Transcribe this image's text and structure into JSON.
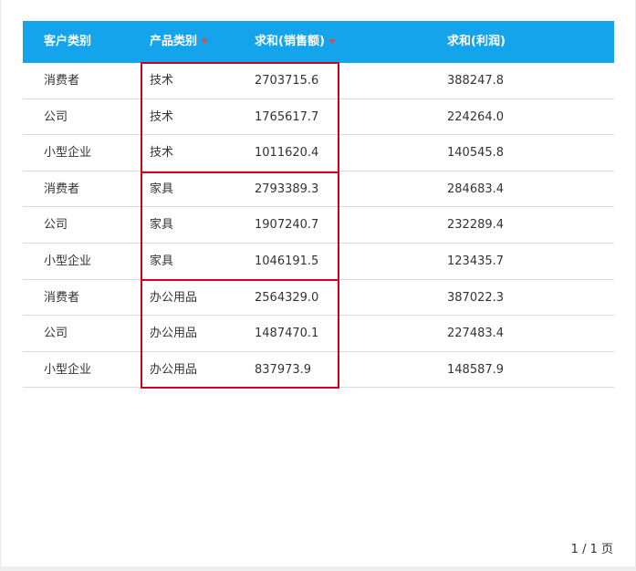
{
  "headers": {
    "customer_type": "客户类别",
    "product_type": "产品类别",
    "sum_sales": "求和(销售额)",
    "sum_profit": "求和(利润)"
  },
  "rows": [
    {
      "customer": "消费者",
      "category": "技术",
      "sales": "2703715.6",
      "profit": "388247.8"
    },
    {
      "customer": "公司",
      "category": "技术",
      "sales": "1765617.7",
      "profit": "224264.0"
    },
    {
      "customer": "小型企业",
      "category": "技术",
      "sales": "1011620.4",
      "profit": "140545.8"
    },
    {
      "customer": "消费者",
      "category": "家具",
      "sales": "2793389.3",
      "profit": "284683.4"
    },
    {
      "customer": "公司",
      "category": "家具",
      "sales": "1907240.7",
      "profit": "232289.4"
    },
    {
      "customer": "小型企业",
      "category": "家具",
      "sales": "1046191.5",
      "profit": "123435.7"
    },
    {
      "customer": "消费者",
      "category": "办公用品",
      "sales": "2564329.0",
      "profit": "387022.3"
    },
    {
      "customer": "公司",
      "category": "办公用品",
      "sales": "1487470.1",
      "profit": "227483.4"
    },
    {
      "customer": "小型企业",
      "category": "办公用品",
      "sales": "837973.9",
      "profit": "148587.9"
    }
  ],
  "pager": {
    "text": "1 / 1 页"
  },
  "colors": {
    "header_bg": "#13a4ec",
    "highlight": "#d0021b",
    "sort_icon": "#e24a3e"
  }
}
